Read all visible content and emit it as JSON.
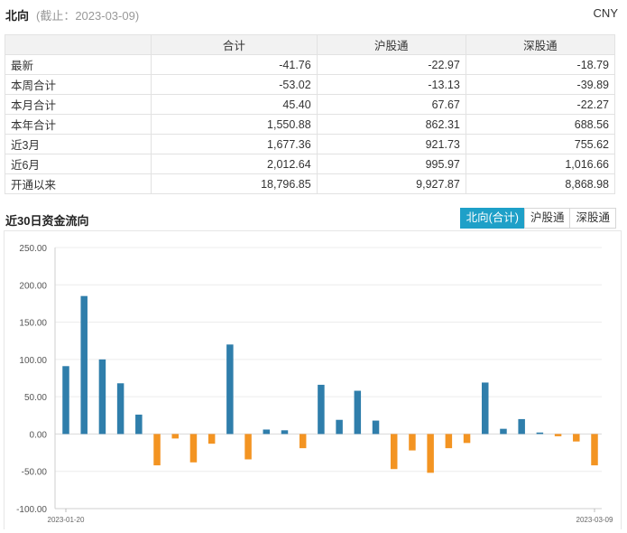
{
  "header": {
    "title": "北向",
    "as_of": "(截止：2023-03-09)",
    "currency": "CNY"
  },
  "table": {
    "columns": [
      "",
      "合计",
      "沪股通",
      "深股通"
    ],
    "rows": [
      {
        "label": "最新",
        "values": [
          "-41.76",
          "-22.97",
          "-18.79"
        ]
      },
      {
        "label": "本周合计",
        "values": [
          "-53.02",
          "-13.13",
          "-39.89"
        ]
      },
      {
        "label": "本月合计",
        "values": [
          "45.40",
          "67.67",
          "-22.27"
        ]
      },
      {
        "label": "本年合计",
        "values": [
          "1,550.88",
          "862.31",
          "688.56"
        ]
      },
      {
        "label": "近3月",
        "values": [
          "1,677.36",
          "921.73",
          "755.62"
        ]
      },
      {
        "label": "近6月",
        "values": [
          "2,012.64",
          "995.97",
          "1,016.66"
        ]
      },
      {
        "label": "开通以来",
        "values": [
          "18,796.85",
          "9,927.87",
          "8,868.98"
        ]
      }
    ]
  },
  "section": {
    "title": "近30日资金流向",
    "tabs": [
      {
        "label": "北向(合计)",
        "active": true
      },
      {
        "label": "沪股通",
        "active": false
      },
      {
        "label": "深股通",
        "active": false
      }
    ]
  },
  "chart_data": {
    "type": "bar",
    "ylim": [
      -100,
      250
    ],
    "yticks": [
      "250.00",
      "200.00",
      "150.00",
      "100.00",
      "50.00",
      "0.00",
      "-50.00",
      "-100.00"
    ],
    "x_start_label": "2023-01-20",
    "x_end_label": "2023-03-09",
    "values": [
      91,
      185,
      100,
      68,
      26,
      -42,
      -6,
      -38,
      -13,
      120,
      -34,
      6,
      5,
      -19,
      66,
      19,
      58,
      18,
      -47,
      -22,
      -52,
      -19,
      -12,
      69,
      7,
      20,
      2,
      -3,
      -10,
      -42
    ],
    "colors": {
      "positive": "#2f7eab",
      "negative": "#f39422"
    },
    "grid": true
  }
}
